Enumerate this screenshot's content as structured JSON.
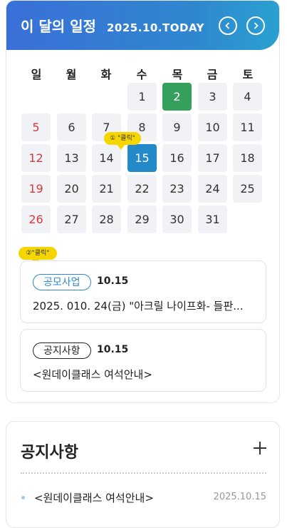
{
  "calendar": {
    "title": "이 달의 일정",
    "date_label": "2025.10.TODAY",
    "weekdays": [
      "일",
      "월",
      "화",
      "수",
      "목",
      "금",
      "토"
    ],
    "days": {
      "d1": "1",
      "d2": "2",
      "d3": "3",
      "d4": "4",
      "d5": "5",
      "d6": "6",
      "d7": "7",
      "d8": "8",
      "d9": "9",
      "d10": "10",
      "d11": "11",
      "d12": "12",
      "d13": "13",
      "d14": "14",
      "d15": "15",
      "d16": "16",
      "d17": "17",
      "d18": "18",
      "d19": "19",
      "d20": "20",
      "d21": "21",
      "d22": "22",
      "d23": "23",
      "d24": "24",
      "d25": "25",
      "d26": "26",
      "d27": "27",
      "d28": "28",
      "d29": "29",
      "d30": "30",
      "d31": "31"
    },
    "bubble1": "① \"클릭\"",
    "bubble2": "②\"클릭\"",
    "colors": {
      "today": "#35a05b",
      "selected": "#2389c8",
      "sunday": "#d23b3b"
    }
  },
  "events": [
    {
      "tag": "공모사업",
      "date": "10.15",
      "text": "2025. 010. 24(금) \"아크릴 나이프화- 들판..."
    },
    {
      "tag": "공지사항",
      "date": "10.15",
      "text": "<원데이클래스 여석안내>"
    }
  ],
  "notice": {
    "title": "공지사항",
    "items": [
      {
        "text": "<원데이클래스 여석안내>",
        "date": "2025.10.15"
      }
    ]
  }
}
